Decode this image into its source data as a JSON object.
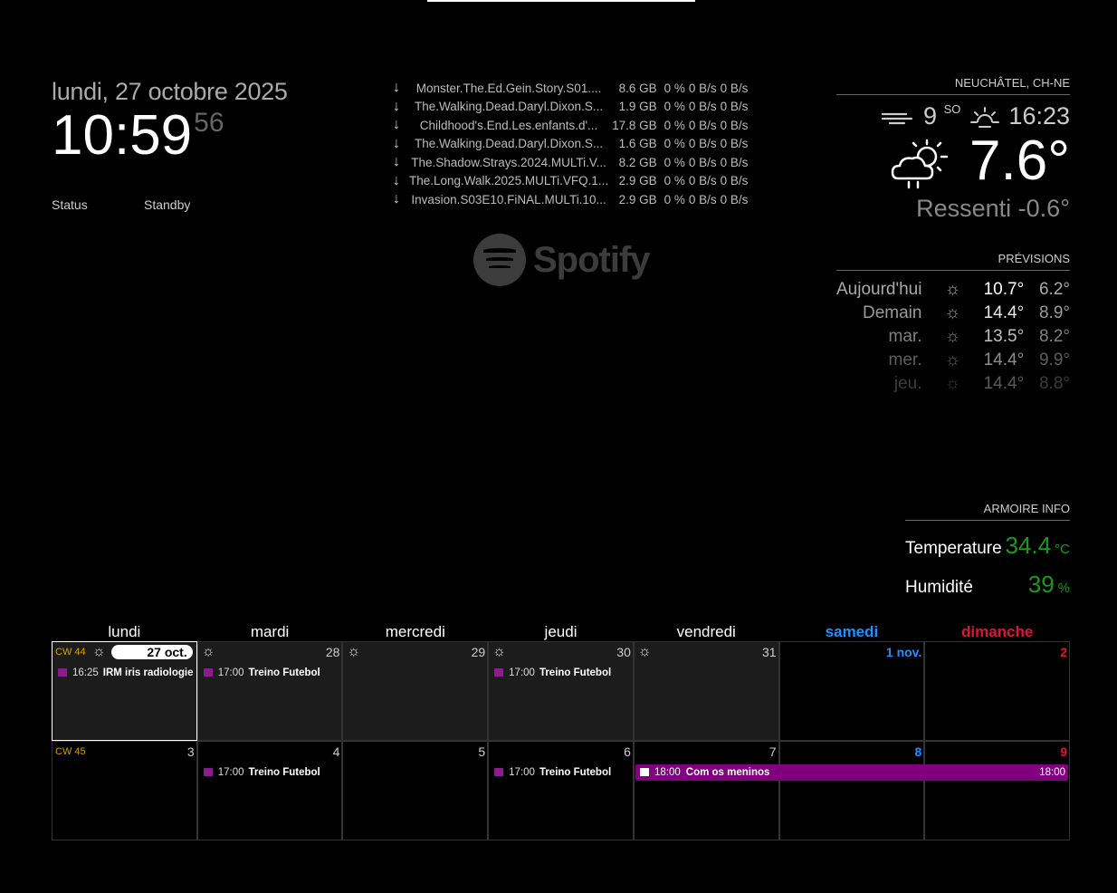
{
  "clock": {
    "date": "lundi, 27 octobre 2025",
    "time": "10:59",
    "seconds": "56",
    "status_label": "Status",
    "status_value": "Standby"
  },
  "torrents": [
    {
      "name": "Monster.The.Ed.Gein.Story.S01....",
      "size": "8.6 GB",
      "progress": "0 %",
      "down": "0 B/s",
      "up": "0 B/s"
    },
    {
      "name": "The.Walking.Dead.Daryl.Dixon.S...",
      "size": "1.9 GB",
      "progress": "0 %",
      "down": "0 B/s",
      "up": "0 B/s"
    },
    {
      "name": "Childhood's.End.Les.enfants.d'...",
      "size": "17.8 GB",
      "progress": "0 %",
      "down": "0 B/s",
      "up": "0 B/s"
    },
    {
      "name": "The.Walking.Dead.Daryl.Dixon.S...",
      "size": "1.6 GB",
      "progress": "0 %",
      "down": "0 B/s",
      "up": "0 B/s"
    },
    {
      "name": "The.Shadow.Strays.2024.MULTi.V...",
      "size": "8.2 GB",
      "progress": "0 %",
      "down": "0 B/s",
      "up": "0 B/s"
    },
    {
      "name": "The.Long.Walk.2025.MULTi.VFQ.1...",
      "size": "2.9 GB",
      "progress": "0 %",
      "down": "0 B/s",
      "up": "0 B/s"
    },
    {
      "name": "Invasion.S03E10.FiNAL.MULTi.10...",
      "size": "2.9 GB",
      "progress": "0 %",
      "down": "0 B/s",
      "up": "0 B/s"
    }
  ],
  "spotify": {
    "brand": "Spotify",
    "icon": "spotify-logo",
    "color": "#3c3c3c"
  },
  "weather": {
    "location": "NEUCHÂTEL, CH-NE",
    "wind_speed": "9",
    "wind_dir": "SO",
    "sunset": "16:23",
    "temperature": "7.6°",
    "feels_like": "Ressenti -0.6°",
    "icons": {
      "wind": "wind-icon",
      "sunset": "sunset-icon",
      "current": "rain-sun-cloud-icon"
    }
  },
  "forecast": {
    "header": "PRÉVISIONS",
    "days": [
      {
        "day": "Aujourd'hui",
        "icon": "cloud-sun-rain-icon",
        "max": "10.7°",
        "min": "6.2°",
        "opacity": 1.0
      },
      {
        "day": "Demain",
        "icon": "sun-cloud-icon",
        "max": "14.4°",
        "min": "8.9°",
        "opacity": 0.9
      },
      {
        "day": "mar.",
        "icon": "cloud-sun-rain-icon",
        "max": "13.5°",
        "min": "8.2°",
        "opacity": 0.75
      },
      {
        "day": "mer.",
        "icon": "cloud-sun-rain-icon",
        "max": "14.4°",
        "min": "9.9°",
        "opacity": 0.55
      },
      {
        "day": "jeu.",
        "icon": "sun-cloud-icon",
        "max": "14.4°",
        "min": "8.8°",
        "opacity": 0.35
      }
    ]
  },
  "armoire": {
    "header": "ARMOIRE INFO",
    "temperature_label": "Temperature",
    "temperature_value": "34.4",
    "temperature_unit": "°C",
    "humidity_label": "Humidité",
    "humidity_value": "39",
    "humidity_unit": "%"
  },
  "calendar": {
    "weekdays": [
      "lundi",
      "mardi",
      "mercredi",
      "jeudi",
      "vendredi",
      "samedi",
      "dimanche"
    ],
    "week1": {
      "cw": "CW 44",
      "days": [
        {
          "num": "27 oct.",
          "icon": "sun-cloud-icon",
          "event_time": "16:25",
          "event_title": "IRM iris radiologie"
        },
        {
          "num": "28",
          "icon": "cloud-sun-rain-icon",
          "event_time": "17:00",
          "event_title": "Treino Futebol"
        },
        {
          "num": "29",
          "icon": "cloud-sun-rain-icon",
          "event_time": "",
          "event_title": ""
        },
        {
          "num": "30",
          "icon": "sun-cloud-icon",
          "event_time": "17:00",
          "event_title": "Treino Futebol"
        },
        {
          "num": "31",
          "icon": "cloud-sun-rain-icon",
          "event_time": "",
          "event_title": ""
        },
        {
          "num": "1 nov.",
          "icon": "",
          "event_time": "",
          "event_title": ""
        },
        {
          "num": "2",
          "icon": "",
          "event_time": "",
          "event_title": ""
        }
      ]
    },
    "week2": {
      "cw": "CW 45",
      "days": [
        {
          "num": "3",
          "event_time": "",
          "event_title": ""
        },
        {
          "num": "4",
          "event_time": "17:00",
          "event_title": "Treino Futebol"
        },
        {
          "num": "5",
          "event_time": "",
          "event_title": ""
        },
        {
          "num": "6",
          "event_time": "17:00",
          "event_title": "Treino Futebol"
        },
        {
          "num": "7",
          "event_time": "",
          "event_title": ""
        },
        {
          "num": "8",
          "event_time": "",
          "event_title": ""
        },
        {
          "num": "9",
          "event_time": "",
          "event_title": ""
        }
      ],
      "multi_event": {
        "time": "18:00",
        "title": "Com os meninos",
        "end_time": "18:00",
        "color": "#800080"
      }
    },
    "colors": {
      "saturday": "#1e90ff",
      "sunday": "#dc143c",
      "cw": "#d4a000",
      "event_icon": "#8b1e8b"
    }
  }
}
